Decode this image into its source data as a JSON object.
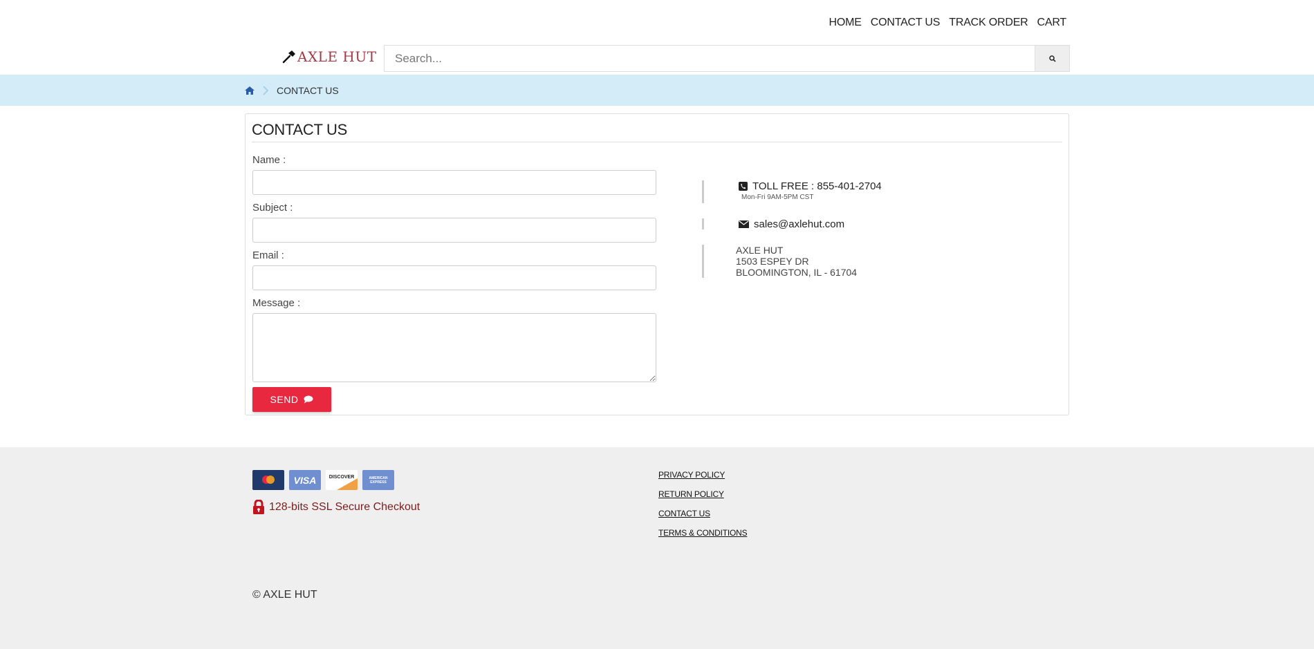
{
  "nav": {
    "items": [
      "HOME",
      "CONTACT US",
      "TRACK ORDER",
      "CART"
    ]
  },
  "header": {
    "logo_text": "AXLE HUT",
    "search_placeholder": "Search..."
  },
  "breadcrumb": {
    "current": "CONTACT US"
  },
  "page": {
    "title": "CONTACT US"
  },
  "form": {
    "name_label": "Name :",
    "subject_label": "Subject :",
    "email_label": "Email :",
    "message_label": "Message :",
    "send_label": "SEND"
  },
  "contact": {
    "toll_free": "TOLL FREE : 855-401-2704",
    "hours": "Mon-Fri 9AM-5PM CST",
    "email": "sales@axlehut.com",
    "address_lines": [
      "AXLE HUT",
      "1503 ESPEY DR",
      "BLOOMINGTON, IL - 61704"
    ]
  },
  "footer": {
    "cards": [
      {
        "name": "MasterCard",
        "label": "mastercard",
        "color": "#1f3a6b"
      },
      {
        "name": "Visa",
        "label": "VISA",
        "color": "#6f8fd0"
      },
      {
        "name": "Discover",
        "label": "DISCOVER",
        "color": "#ffffff"
      },
      {
        "name": "American Express",
        "label": "AMERICAN EXPRESS",
        "color": "#6f8fd0"
      }
    ],
    "ssl_text": "128-bits SSL Secure Checkout",
    "links": [
      "PRIVACY POLICY",
      "RETURN POLICY",
      "CONTACT US",
      "TERMS & CONDITIONS"
    ],
    "copyright": "© AXLE HUT"
  },
  "colors": {
    "accent": "#e8283e",
    "breadcrumb_bg": "#d3ecf8",
    "logo": "#a33a45",
    "footer_bg": "#efefef"
  }
}
